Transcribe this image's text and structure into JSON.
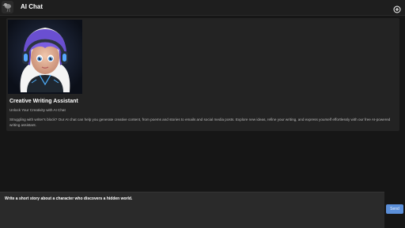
{
  "header": {
    "title": "AI Chat",
    "logo_icon": "bird-logo-icon",
    "new_chat_icon": "plus-circle-icon"
  },
  "assistant_card": {
    "avatar_icon": "headphones-girl-avatar",
    "title": "Creative Writing Assistant",
    "subtitle": "Unlock Your Creativity with AI Chat",
    "description": "Struggling with writer's block? Our AI chat can help you generate creative content, from poems and stories to emails and social media posts. Explore new ideas, refine your writing, and express yourself effortlessly with our free AI-powered writing assistant."
  },
  "composer": {
    "value": "Write a short story about a character who discovers a hidden world.",
    "send_label": "Send"
  },
  "colors": {
    "background": "#161616",
    "card": "#232323",
    "composer": "#2a2a2a",
    "send_button": "#5b8fd9"
  }
}
